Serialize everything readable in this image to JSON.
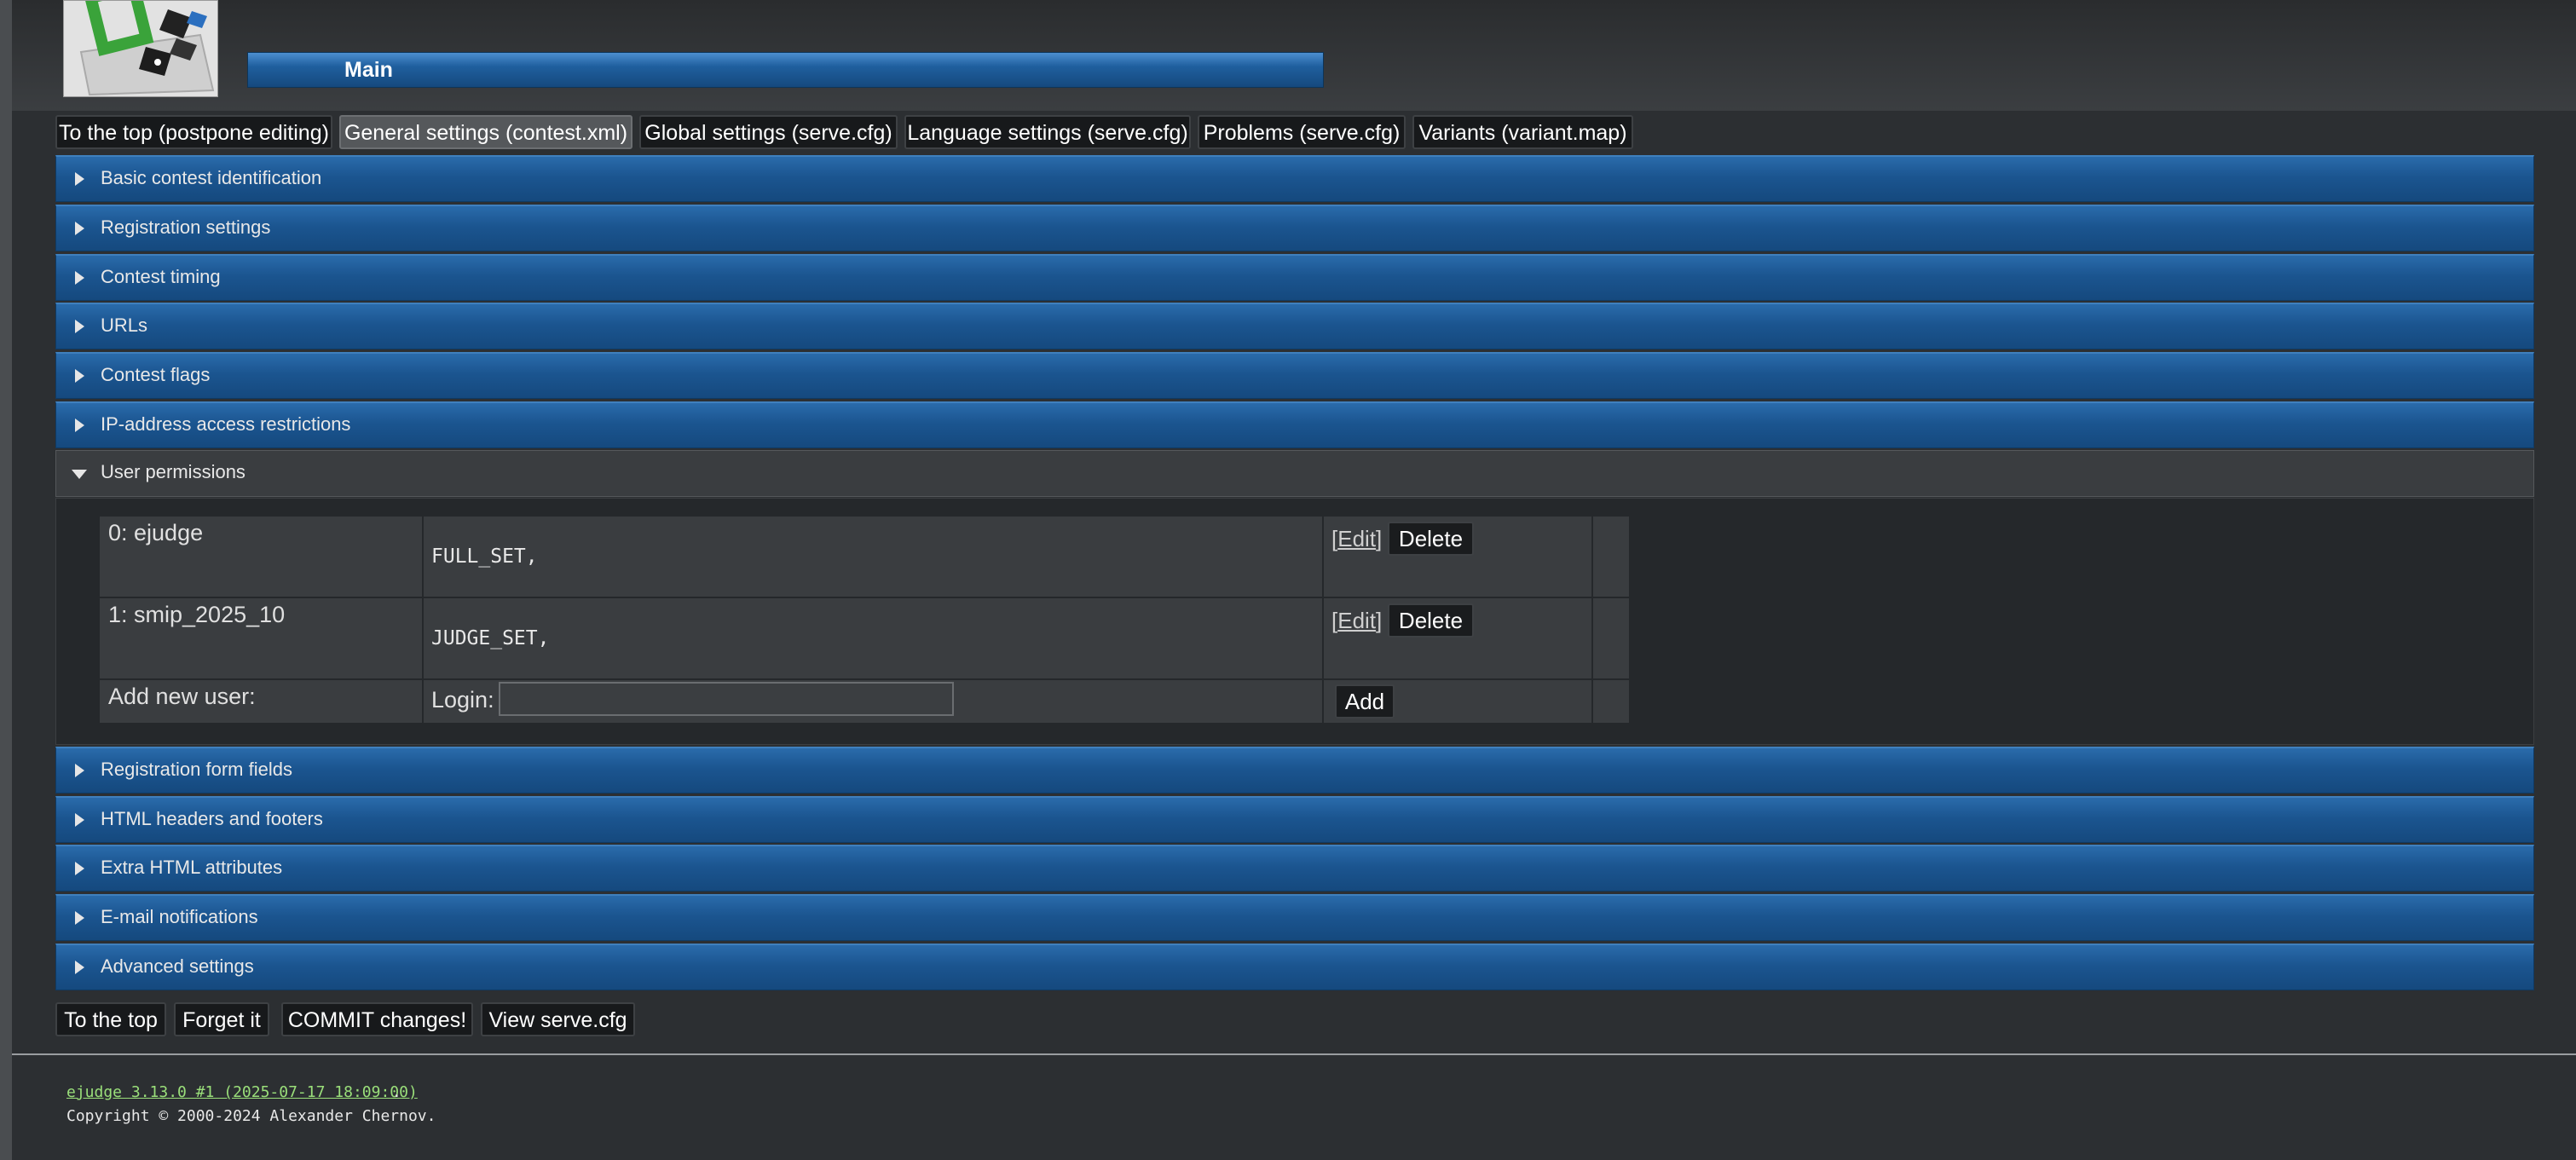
{
  "header": {
    "main_label": "Main"
  },
  "tabs": [
    "To the top (postpone editing)",
    "General settings (contest.xml)",
    "Global settings (serve.cfg)",
    "Language settings (serve.cfg)",
    "Problems (serve.cfg)",
    "Variants (variant.map)"
  ],
  "active_tab": "General settings (contest.xml)",
  "sections": [
    "Basic contest identification",
    "Registration settings",
    "Contest timing",
    "URLs",
    "Contest flags",
    "IP-address access restrictions",
    "User permissions",
    "Registration form fields",
    "HTML headers and footers",
    "Extra HTML attributes",
    "E-mail notifications",
    "Advanced settings"
  ],
  "expanded_section": "User permissions",
  "permissions": {
    "users": [
      {
        "label": "0: ejudge",
        "caps": "FULL_SET,"
      },
      {
        "label": "1: smip_2025_10",
        "caps": "JUDGE_SET,"
      }
    ],
    "edit_label": "Edit",
    "delete_label": "Delete",
    "add_new_label": "Add new user:",
    "login_label": "Login:",
    "login_value": "",
    "add_label": "Add"
  },
  "bottom_buttons": [
    "To the top",
    "Forget it",
    "COMMIT changes!",
    "View serve.cfg"
  ],
  "footer": {
    "version_link": "ejudge 3.13.0 #1 (2025-07-17 18:09:00)",
    "version_suffix": ".",
    "copyright": "Copyright © 2000-2024 Alexander Chernov."
  }
}
